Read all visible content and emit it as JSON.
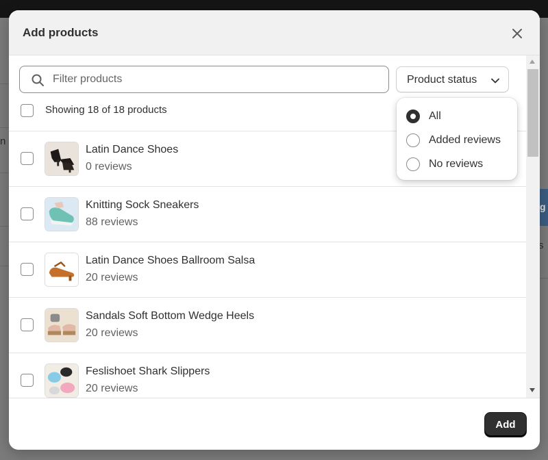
{
  "modal": {
    "title": "Add products",
    "close_icon": "close-icon",
    "search": {
      "placeholder": "Filter products",
      "value": ""
    },
    "status_filter": {
      "label": "Product status"
    },
    "showing_text": "Showing 18 of 18 products",
    "products": [
      {
        "name": "Latin Dance Shoes",
        "reviews": "0 reviews"
      },
      {
        "name": "Knitting Sock Sneakers",
        "reviews": "88 reviews"
      },
      {
        "name": "Latin Dance Shoes Ballroom Salsa",
        "reviews": "20 reviews"
      },
      {
        "name": "Sandals Soft Bottom Wedge Heels",
        "reviews": "20 reviews"
      },
      {
        "name": "Feslishoet Shark Slippers",
        "reviews": "20 reviews"
      }
    ],
    "add_label": "Add"
  },
  "dropdown": {
    "options": [
      {
        "label": "All",
        "selected": true
      },
      {
        "label": "Added reviews",
        "selected": false
      },
      {
        "label": "No reviews",
        "selected": false
      }
    ]
  },
  "background": {
    "edge_text": "n",
    "right_button_text": "g",
    "right_text": "s"
  },
  "colors": {
    "primary_button": "#303030",
    "overlay": "#7b7b7b",
    "header_bg": "#f1f1f1"
  }
}
